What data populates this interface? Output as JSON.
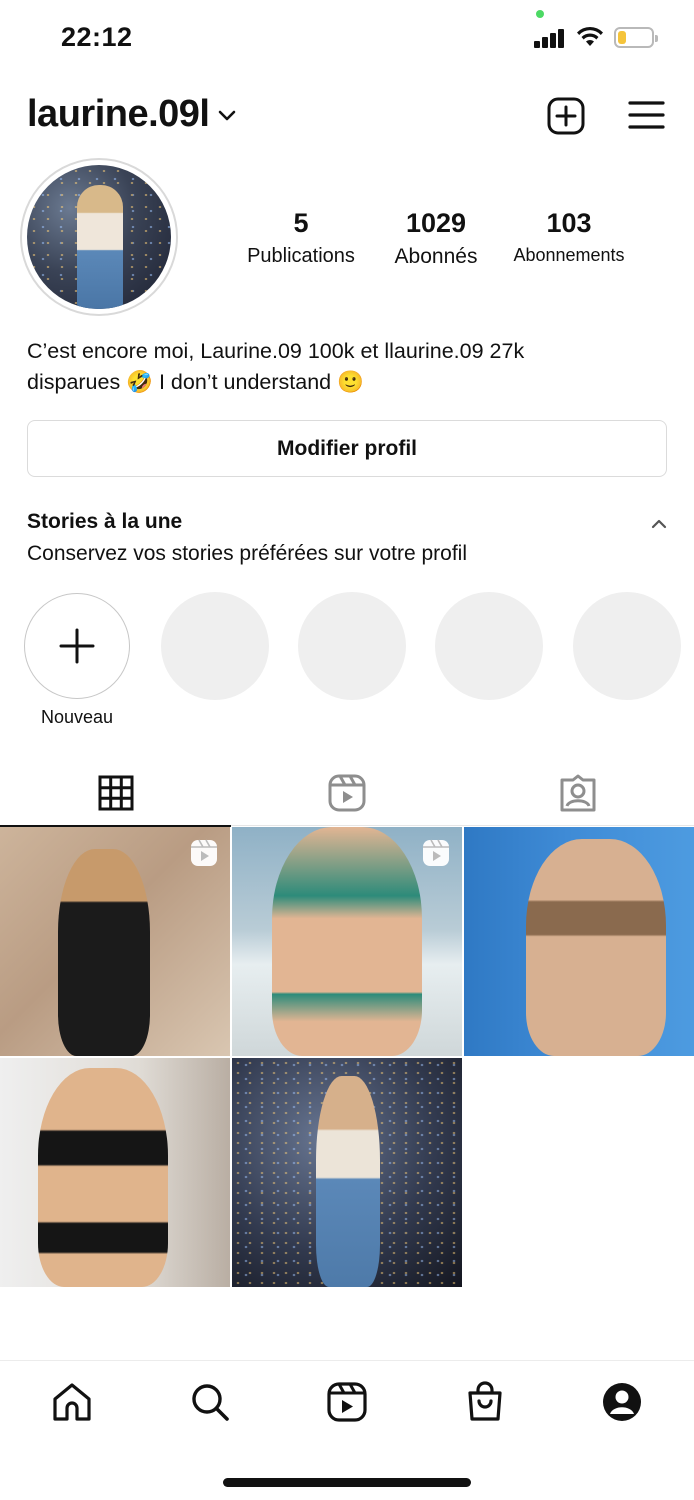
{
  "status_bar": {
    "time": "22:12",
    "battery_level": 0.25,
    "battery_color": "#f5c43b"
  },
  "header": {
    "username": "laurine.09l",
    "icons": [
      "chevron-down-icon",
      "add-post-icon",
      "menu-icon"
    ]
  },
  "profile": {
    "stats": [
      {
        "value": "5",
        "label": "Publications"
      },
      {
        "value": "1029",
        "label": "Abonnés"
      },
      {
        "value": "103",
        "label": "Abonnements"
      }
    ],
    "bio_line1": "C’est encore moi, Laurine.09 100k et llaurine.09 27k",
    "bio_line2_a": "disparues",
    "bio_emoji1": "🤣",
    "bio_line2_b": "I don’t understand",
    "bio_emoji2": "🙂",
    "edit_button_label": "Modifier profil"
  },
  "highlights": {
    "title": "Stories à la une",
    "subtitle": "Conservez vos stories préférées sur votre profil",
    "new_label": "Nouveau",
    "placeholder_count": 4
  },
  "tabs": [
    {
      "icon": "grid-icon",
      "active": true
    },
    {
      "icon": "reels-icon",
      "active": false
    },
    {
      "icon": "tagged-icon",
      "active": false
    }
  ],
  "posts": [
    {
      "type": "reel"
    },
    {
      "type": "reel"
    },
    {
      "type": "photo"
    },
    {
      "type": "photo"
    },
    {
      "type": "photo"
    }
  ],
  "bottom_nav": [
    "home-icon",
    "search-icon",
    "reels-icon",
    "shop-icon",
    "profile-icon"
  ],
  "colors": {
    "accent": "#111111",
    "border": "#dbdbdb",
    "placeholder": "#efefef",
    "status_green": "#4cd964"
  }
}
